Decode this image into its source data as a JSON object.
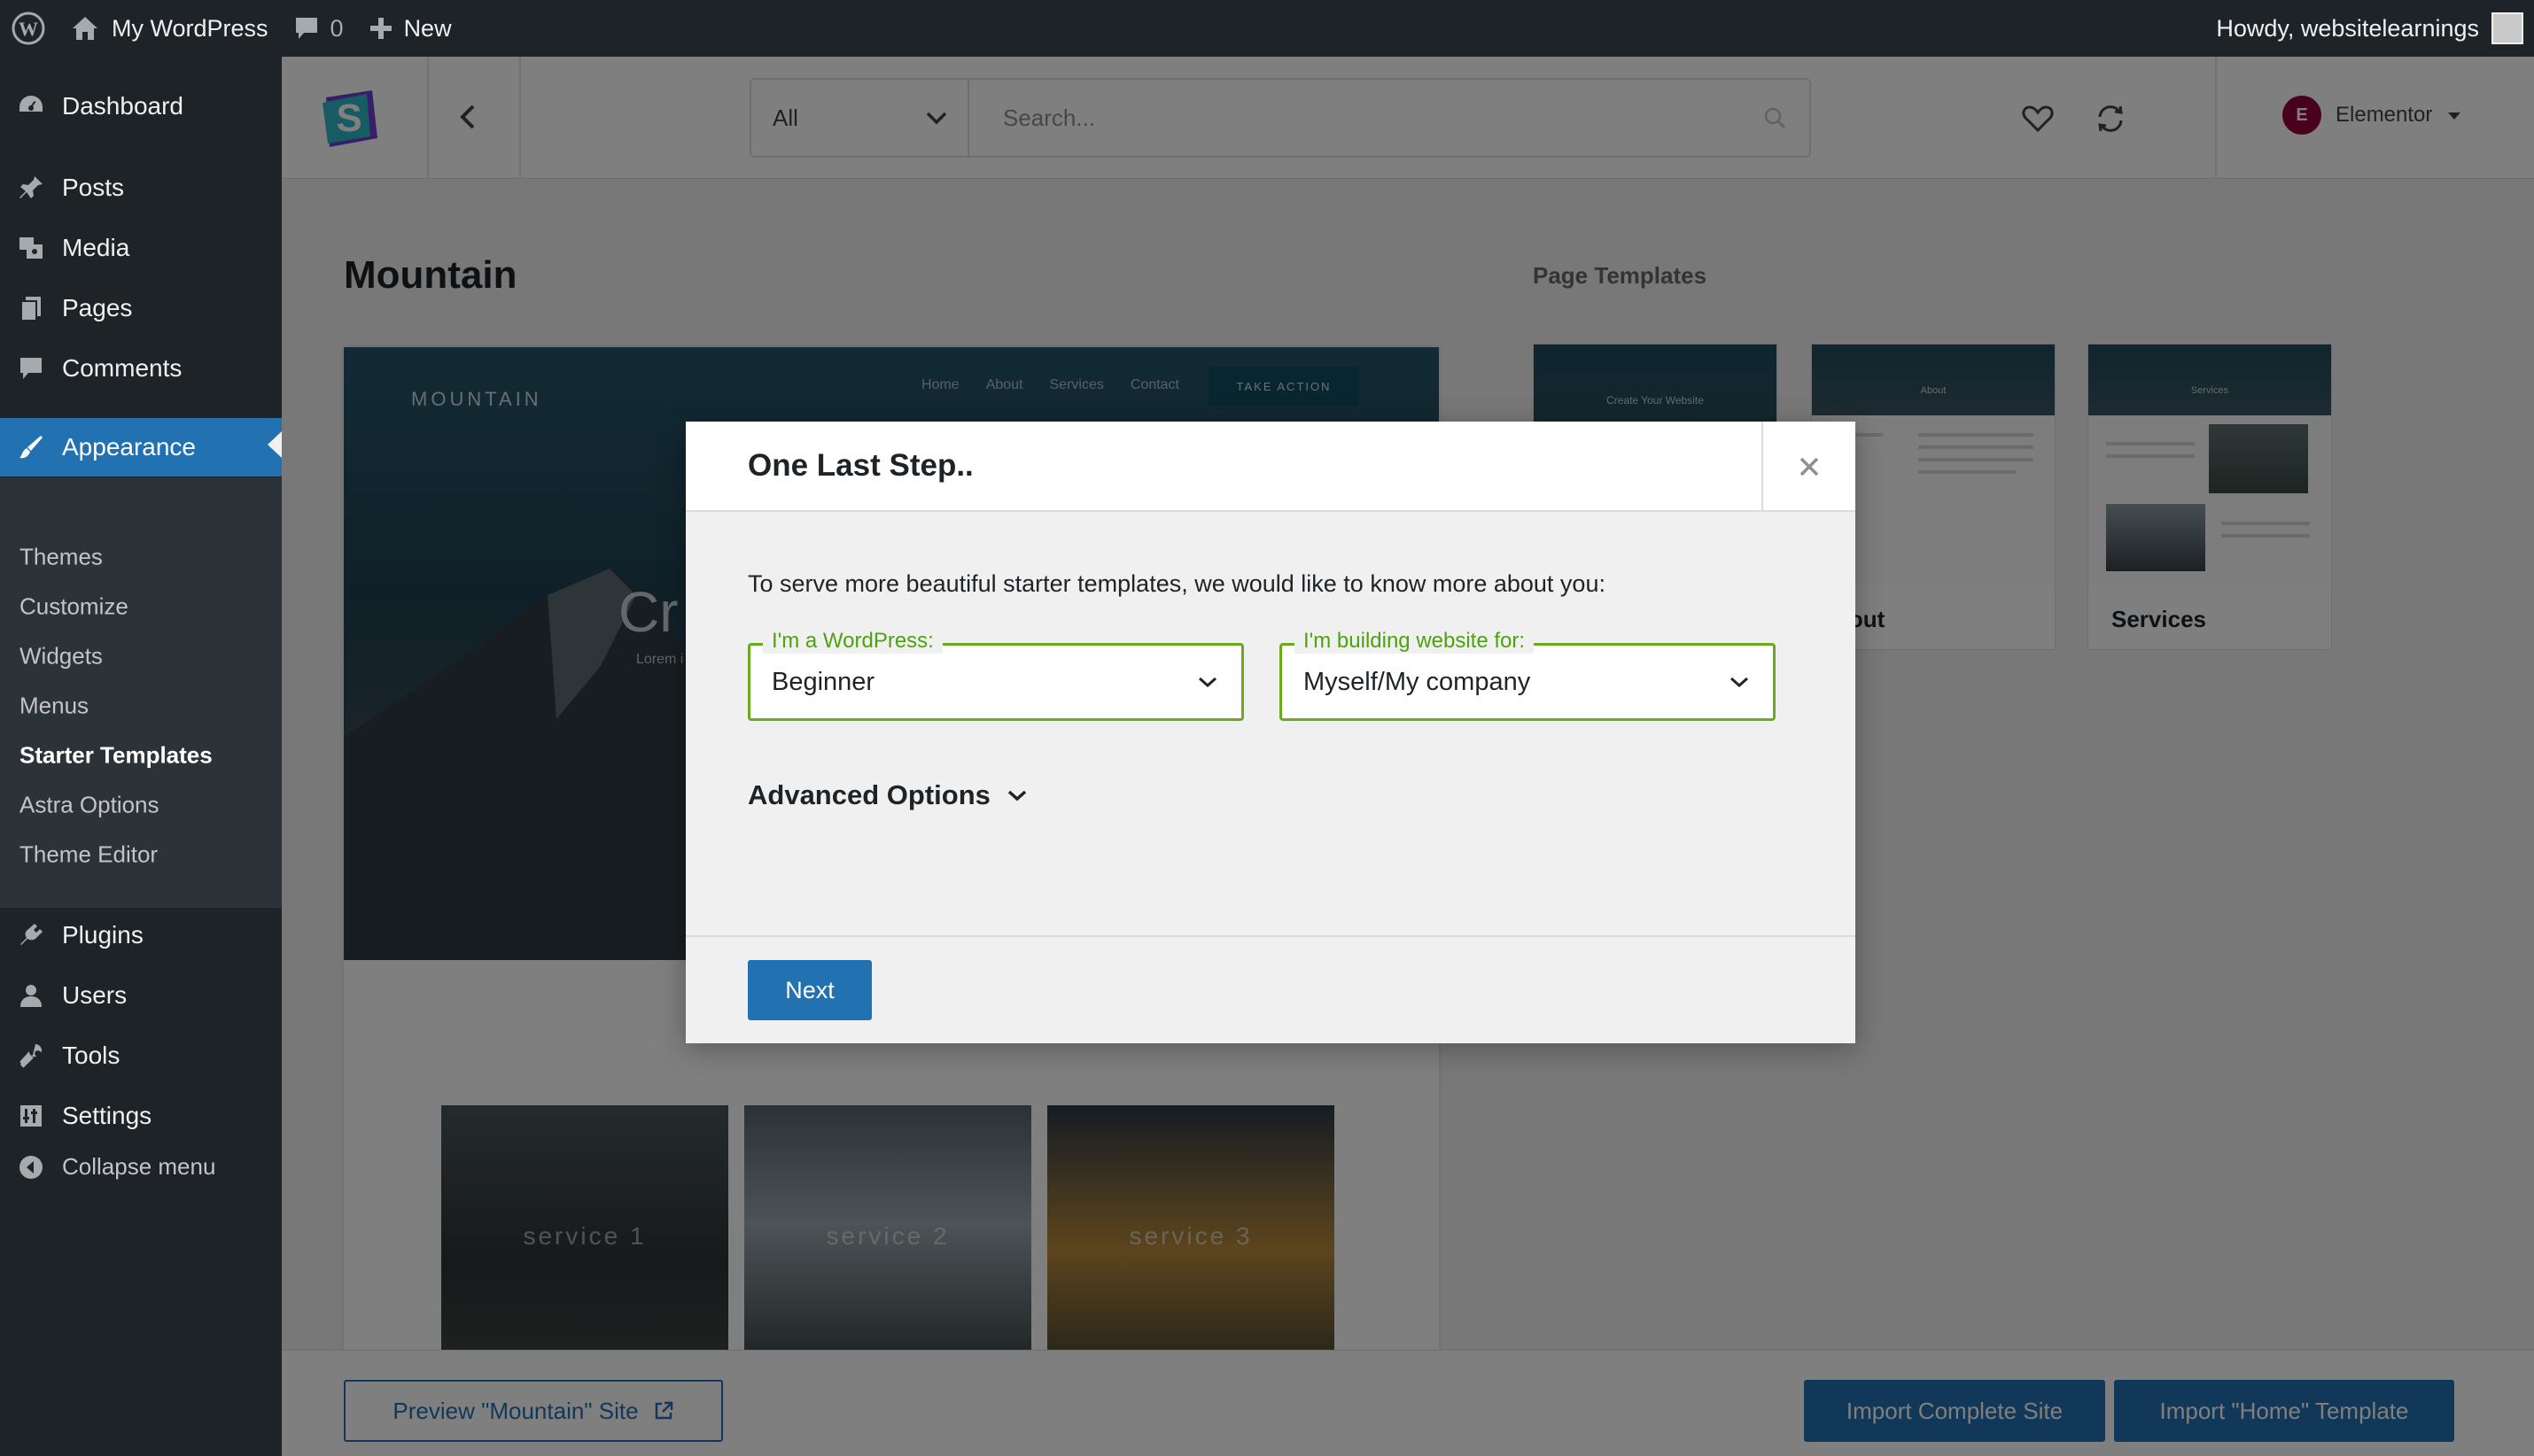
{
  "admin_bar": {
    "site_name": "My WordPress",
    "comments_count": "0",
    "new_label": "New",
    "greeting": "Howdy, websitelearnings"
  },
  "sidebar": {
    "items": [
      {
        "label": "Dashboard",
        "icon": "dashboard-icon"
      },
      {
        "label": "Posts",
        "icon": "pin-icon"
      },
      {
        "label": "Media",
        "icon": "media-icon"
      },
      {
        "label": "Pages",
        "icon": "pages-icon"
      },
      {
        "label": "Comments",
        "icon": "comment-icon"
      },
      {
        "label": "Appearance",
        "icon": "brush-icon"
      },
      {
        "label": "Plugins",
        "icon": "plugin-icon"
      },
      {
        "label": "Users",
        "icon": "user-icon"
      },
      {
        "label": "Tools",
        "icon": "wrench-icon"
      },
      {
        "label": "Settings",
        "icon": "settings-icon"
      }
    ],
    "submenu": [
      "Themes",
      "Customize",
      "Widgets",
      "Menus",
      "Starter Templates",
      "Astra Options",
      "Theme Editor"
    ],
    "collapse_label": "Collapse menu"
  },
  "topbar": {
    "filter_value": "All",
    "search_placeholder": "Search...",
    "builder_label": "Elementor",
    "builder_badge": "E"
  },
  "site": {
    "title": "Mountain",
    "page_templates_heading": "Page Templates",
    "logo_text": "MOUNTAIN",
    "nav": [
      "Home",
      "About",
      "Services",
      "Contact"
    ],
    "cta": "TAKE ACTION",
    "hero_word": "Cr",
    "hero_sub": "Lorem i",
    "services": [
      "service 1",
      "service 2",
      "service 3"
    ],
    "thumb_hero_text": [
      "Create Your Website",
      "About",
      "Services"
    ],
    "page_templates": [
      "",
      "bout",
      "Services"
    ]
  },
  "bottom": {
    "preview_label": "Preview \"Mountain\" Site",
    "import_site_label": "Import Complete Site",
    "import_template_label": "Import \"Home\" Template"
  },
  "modal": {
    "title": "One Last Step..",
    "intro": "To serve more beautiful starter templates, we would like to know more about you:",
    "field1_label": "I'm a WordPress:",
    "field1_value": "Beginner",
    "field2_label": "I'm building website for:",
    "field2_value": "Myself/My company",
    "advanced_label": "Advanced Options",
    "next_label": "Next"
  },
  "colors": {
    "admin_dark": "#1d2327",
    "wp_blue": "#2271b1",
    "field_green": "#6aaa1e",
    "elementor": "#92003b"
  }
}
